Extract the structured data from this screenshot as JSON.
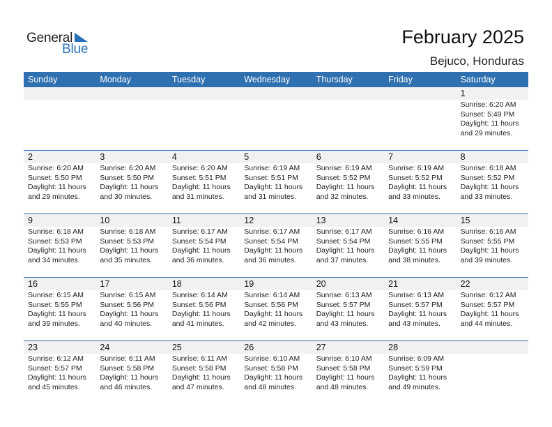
{
  "logo": {
    "general": "General",
    "blue": "Blue"
  },
  "header": {
    "title": "February 2025",
    "location": "Bejuco, Honduras"
  },
  "colors": {
    "accent": "#2e70b0",
    "logo_blue": "#2a72b8",
    "day_bar": "#f1f1f1"
  },
  "weekdays": [
    "Sunday",
    "Monday",
    "Tuesday",
    "Wednesday",
    "Thursday",
    "Friday",
    "Saturday"
  ],
  "weeks": [
    [
      null,
      null,
      null,
      null,
      null,
      null,
      {
        "day": "1",
        "sunrise": "Sunrise: 6:20 AM",
        "sunset": "Sunset: 5:49 PM",
        "daylight1": "Daylight: 11 hours",
        "daylight2": "and 29 minutes."
      }
    ],
    [
      {
        "day": "2",
        "sunrise": "Sunrise: 6:20 AM",
        "sunset": "Sunset: 5:50 PM",
        "daylight1": "Daylight: 11 hours",
        "daylight2": "and 29 minutes."
      },
      {
        "day": "3",
        "sunrise": "Sunrise: 6:20 AM",
        "sunset": "Sunset: 5:50 PM",
        "daylight1": "Daylight: 11 hours",
        "daylight2": "and 30 minutes."
      },
      {
        "day": "4",
        "sunrise": "Sunrise: 6:20 AM",
        "sunset": "Sunset: 5:51 PM",
        "daylight1": "Daylight: 11 hours",
        "daylight2": "and 31 minutes."
      },
      {
        "day": "5",
        "sunrise": "Sunrise: 6:19 AM",
        "sunset": "Sunset: 5:51 PM",
        "daylight1": "Daylight: 11 hours",
        "daylight2": "and 31 minutes."
      },
      {
        "day": "6",
        "sunrise": "Sunrise: 6:19 AM",
        "sunset": "Sunset: 5:52 PM",
        "daylight1": "Daylight: 11 hours",
        "daylight2": "and 32 minutes."
      },
      {
        "day": "7",
        "sunrise": "Sunrise: 6:19 AM",
        "sunset": "Sunset: 5:52 PM",
        "daylight1": "Daylight: 11 hours",
        "daylight2": "and 33 minutes."
      },
      {
        "day": "8",
        "sunrise": "Sunrise: 6:18 AM",
        "sunset": "Sunset: 5:52 PM",
        "daylight1": "Daylight: 11 hours",
        "daylight2": "and 33 minutes."
      }
    ],
    [
      {
        "day": "9",
        "sunrise": "Sunrise: 6:18 AM",
        "sunset": "Sunset: 5:53 PM",
        "daylight1": "Daylight: 11 hours",
        "daylight2": "and 34 minutes."
      },
      {
        "day": "10",
        "sunrise": "Sunrise: 6:18 AM",
        "sunset": "Sunset: 5:53 PM",
        "daylight1": "Daylight: 11 hours",
        "daylight2": "and 35 minutes."
      },
      {
        "day": "11",
        "sunrise": "Sunrise: 6:17 AM",
        "sunset": "Sunset: 5:54 PM",
        "daylight1": "Daylight: 11 hours",
        "daylight2": "and 36 minutes."
      },
      {
        "day": "12",
        "sunrise": "Sunrise: 6:17 AM",
        "sunset": "Sunset: 5:54 PM",
        "daylight1": "Daylight: 11 hours",
        "daylight2": "and 36 minutes."
      },
      {
        "day": "13",
        "sunrise": "Sunrise: 6:17 AM",
        "sunset": "Sunset: 5:54 PM",
        "daylight1": "Daylight: 11 hours",
        "daylight2": "and 37 minutes."
      },
      {
        "day": "14",
        "sunrise": "Sunrise: 6:16 AM",
        "sunset": "Sunset: 5:55 PM",
        "daylight1": "Daylight: 11 hours",
        "daylight2": "and 38 minutes."
      },
      {
        "day": "15",
        "sunrise": "Sunrise: 6:16 AM",
        "sunset": "Sunset: 5:55 PM",
        "daylight1": "Daylight: 11 hours",
        "daylight2": "and 39 minutes."
      }
    ],
    [
      {
        "day": "16",
        "sunrise": "Sunrise: 6:15 AM",
        "sunset": "Sunset: 5:55 PM",
        "daylight1": "Daylight: 11 hours",
        "daylight2": "and 39 minutes."
      },
      {
        "day": "17",
        "sunrise": "Sunrise: 6:15 AM",
        "sunset": "Sunset: 5:56 PM",
        "daylight1": "Daylight: 11 hours",
        "daylight2": "and 40 minutes."
      },
      {
        "day": "18",
        "sunrise": "Sunrise: 6:14 AM",
        "sunset": "Sunset: 5:56 PM",
        "daylight1": "Daylight: 11 hours",
        "daylight2": "and 41 minutes."
      },
      {
        "day": "19",
        "sunrise": "Sunrise: 6:14 AM",
        "sunset": "Sunset: 5:56 PM",
        "daylight1": "Daylight: 11 hours",
        "daylight2": "and 42 minutes."
      },
      {
        "day": "20",
        "sunrise": "Sunrise: 6:13 AM",
        "sunset": "Sunset: 5:57 PM",
        "daylight1": "Daylight: 11 hours",
        "daylight2": "and 43 minutes."
      },
      {
        "day": "21",
        "sunrise": "Sunrise: 6:13 AM",
        "sunset": "Sunset: 5:57 PM",
        "daylight1": "Daylight: 11 hours",
        "daylight2": "and 43 minutes."
      },
      {
        "day": "22",
        "sunrise": "Sunrise: 6:12 AM",
        "sunset": "Sunset: 5:57 PM",
        "daylight1": "Daylight: 11 hours",
        "daylight2": "and 44 minutes."
      }
    ],
    [
      {
        "day": "23",
        "sunrise": "Sunrise: 6:12 AM",
        "sunset": "Sunset: 5:57 PM",
        "daylight1": "Daylight: 11 hours",
        "daylight2": "and 45 minutes."
      },
      {
        "day": "24",
        "sunrise": "Sunrise: 6:11 AM",
        "sunset": "Sunset: 5:58 PM",
        "daylight1": "Daylight: 11 hours",
        "daylight2": "and 46 minutes."
      },
      {
        "day": "25",
        "sunrise": "Sunrise: 6:11 AM",
        "sunset": "Sunset: 5:58 PM",
        "daylight1": "Daylight: 11 hours",
        "daylight2": "and 47 minutes."
      },
      {
        "day": "26",
        "sunrise": "Sunrise: 6:10 AM",
        "sunset": "Sunset: 5:58 PM",
        "daylight1": "Daylight: 11 hours",
        "daylight2": "and 48 minutes."
      },
      {
        "day": "27",
        "sunrise": "Sunrise: 6:10 AM",
        "sunset": "Sunset: 5:58 PM",
        "daylight1": "Daylight: 11 hours",
        "daylight2": "and 48 minutes."
      },
      {
        "day": "28",
        "sunrise": "Sunrise: 6:09 AM",
        "sunset": "Sunset: 5:59 PM",
        "daylight1": "Daylight: 11 hours",
        "daylight2": "and 49 minutes."
      },
      null
    ]
  ]
}
